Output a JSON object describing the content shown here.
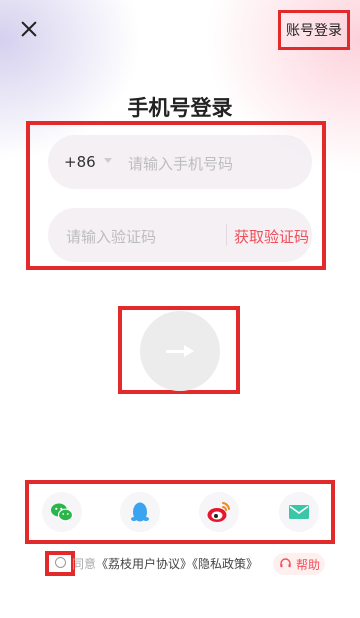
{
  "header": {
    "close_icon": "close-icon",
    "account_login_label": "账号登录"
  },
  "page": {
    "title": "手机号登录"
  },
  "phone": {
    "country_code": "+86",
    "placeholder": "请输入手机号码"
  },
  "code": {
    "placeholder": "请输入验证码",
    "get_code_label": "获取验证码"
  },
  "submit": {
    "icon": "arrow-right-icon"
  },
  "social": {
    "items": [
      {
        "name": "wechat-icon"
      },
      {
        "name": "qq-icon"
      },
      {
        "name": "weibo-icon"
      },
      {
        "name": "mail-icon"
      }
    ]
  },
  "agreement": {
    "prefix": "同意",
    "user_agreement": "《荔枝用户协议》",
    "privacy_policy": "《隐私政策》"
  },
  "help": {
    "label": "帮助"
  },
  "colors": {
    "highlight_border": "#e32a2a",
    "accent": "#f0505a",
    "wechat": "#2ab64a",
    "qq": "#3aa4f0",
    "weibo": "#e6162d",
    "mail": "#3cc6a8"
  }
}
